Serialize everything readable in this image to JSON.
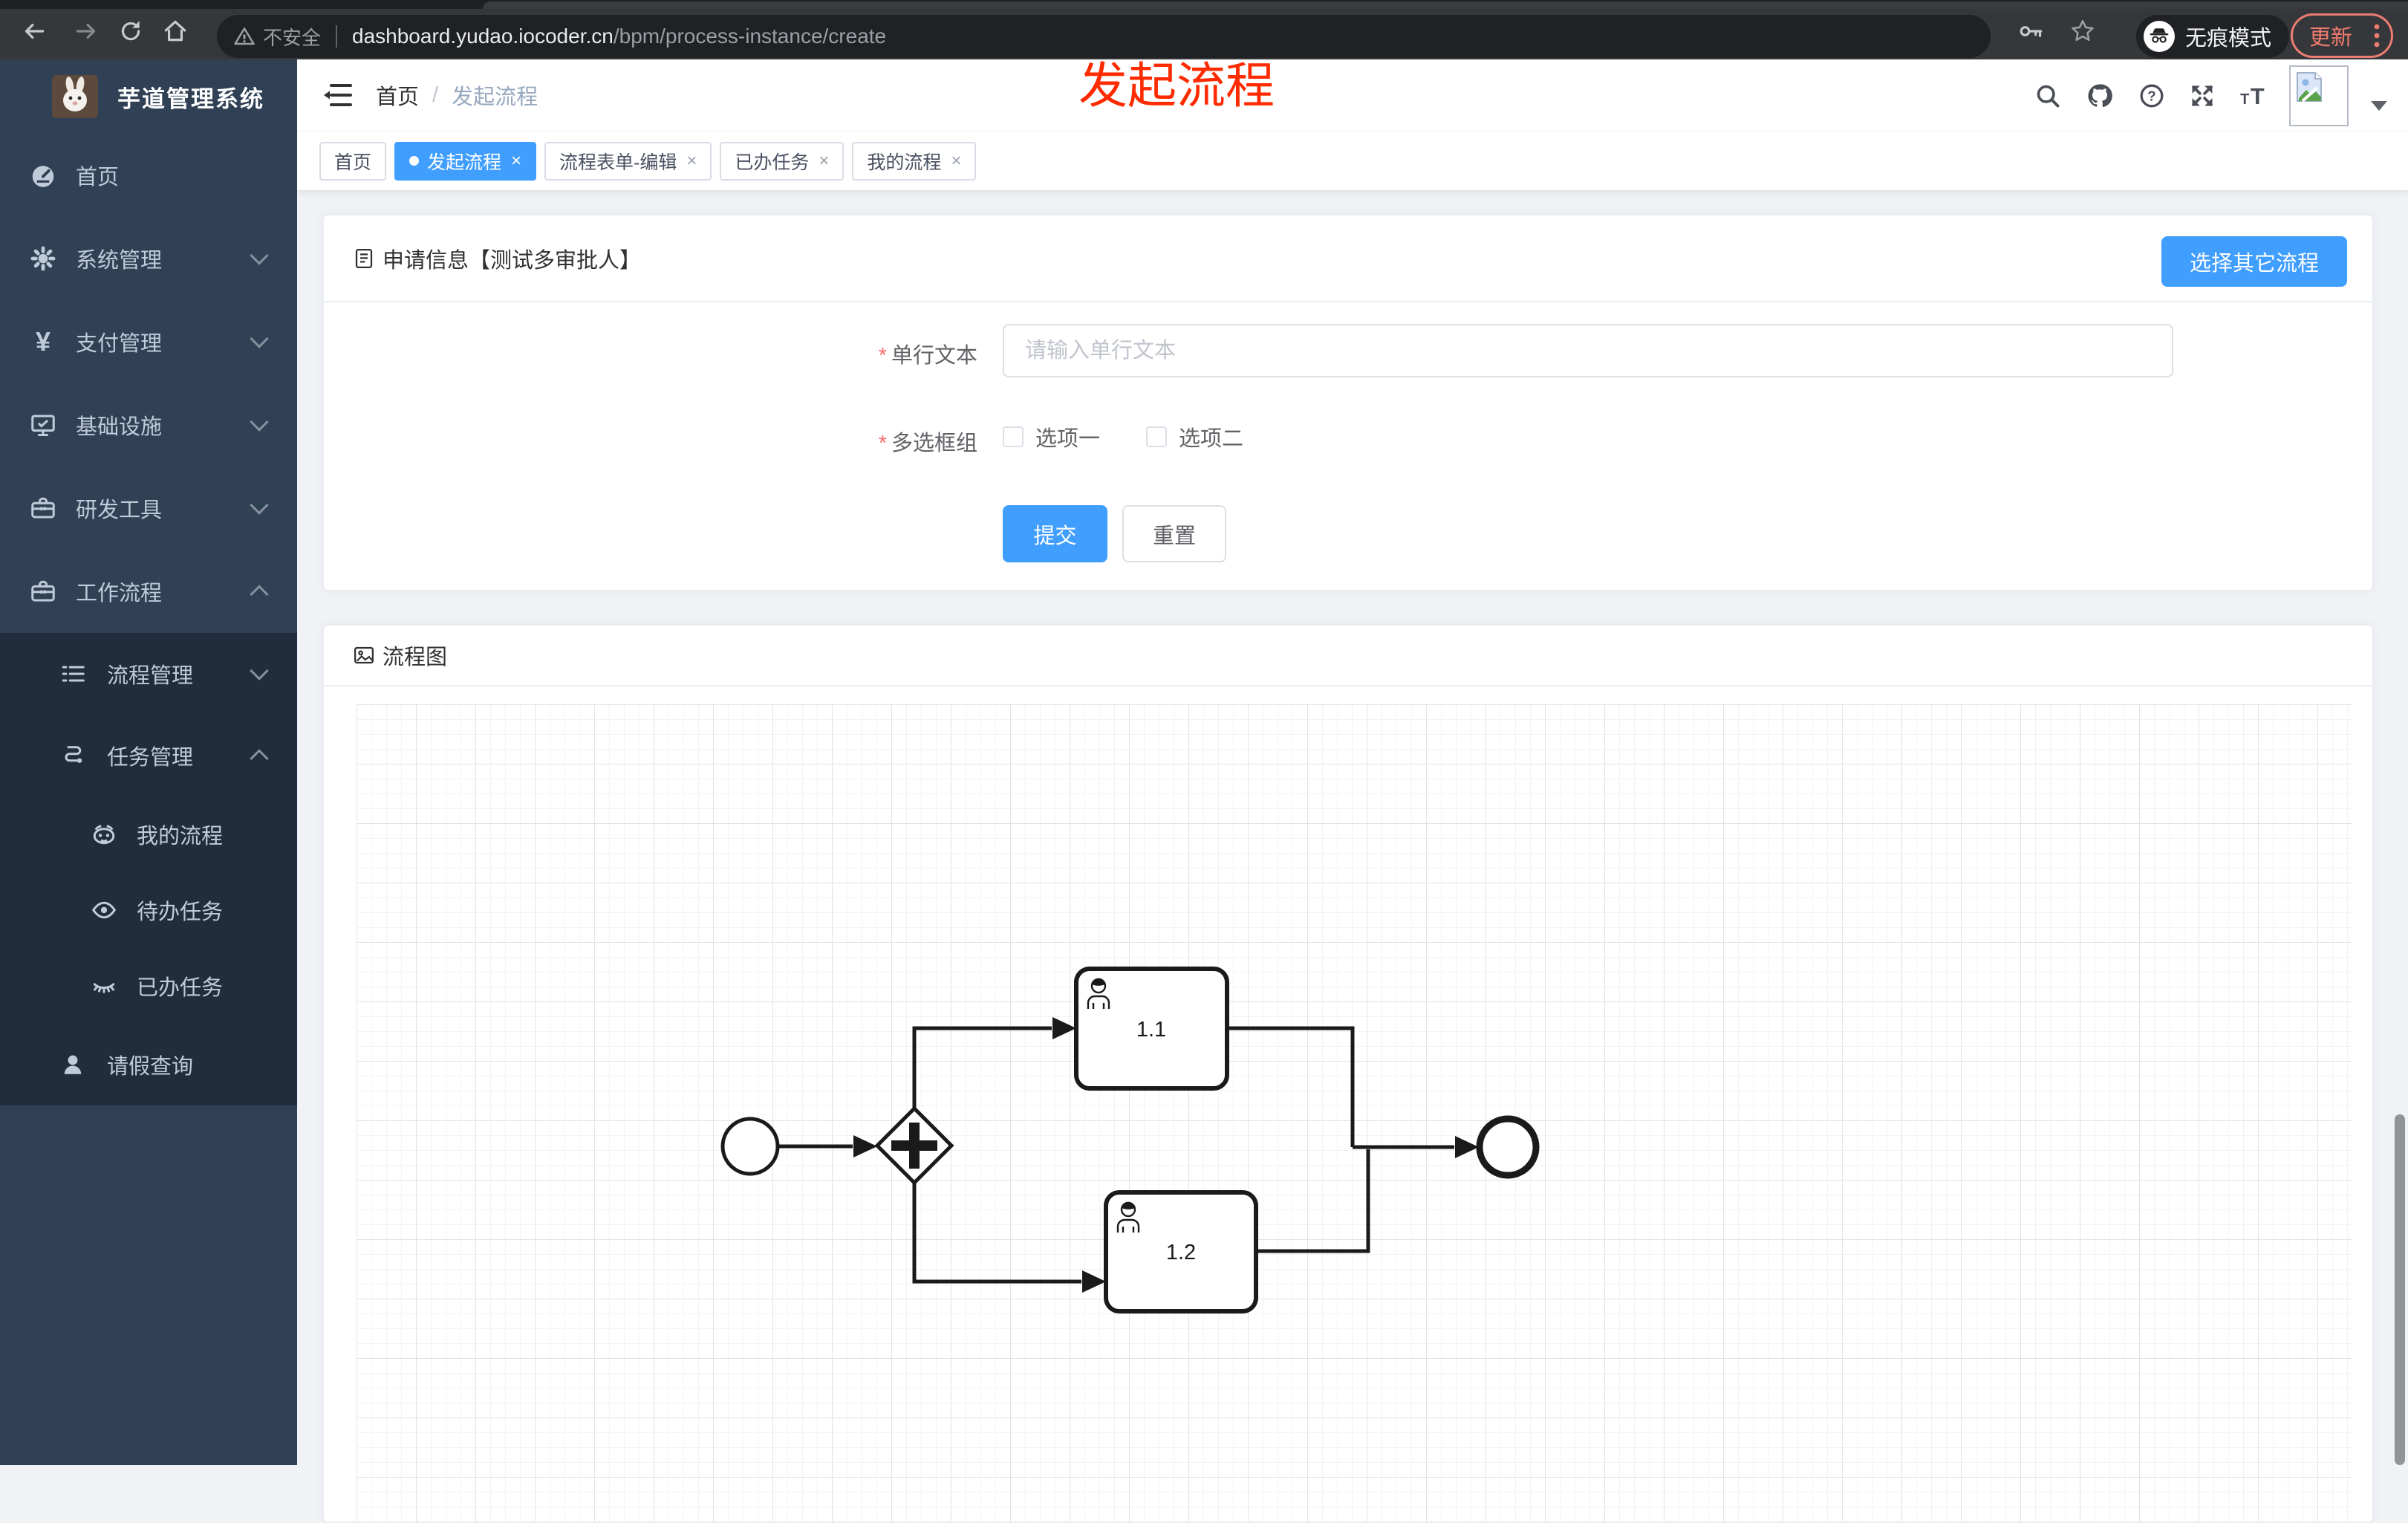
{
  "browser": {
    "security_label": "不安全",
    "url_host": "dashboard.yudao.iocoder.cn",
    "url_path": "/bpm/process-instance/create",
    "incognito_label": "无痕模式",
    "update_label": "更新"
  },
  "annotation": {
    "text": "发起流程",
    "color": "#ff2b00"
  },
  "sidebar": {
    "title": "芋道管理系统",
    "items": [
      {
        "label": "首页",
        "icon": "dashboard-icon",
        "level": 1
      },
      {
        "label": "系统管理",
        "icon": "gear-icon",
        "level": 1,
        "chevron": "down"
      },
      {
        "label": "支付管理",
        "icon": "yen-icon",
        "level": 1,
        "chevron": "down"
      },
      {
        "label": "基础设施",
        "icon": "monitor-icon",
        "level": 1,
        "chevron": "down"
      },
      {
        "label": "研发工具",
        "icon": "toolbox-icon",
        "level": 1,
        "chevron": "down"
      },
      {
        "label": "工作流程",
        "icon": "workflow-icon",
        "level": 1,
        "chevron": "up",
        "expanded": true
      },
      {
        "label": "流程管理",
        "icon": "process-list-icon",
        "level": 2,
        "chevron": "down"
      },
      {
        "label": "任务管理",
        "icon": "task-flow-icon",
        "level": 2,
        "chevron": "up",
        "expanded": true
      },
      {
        "label": "我的流程",
        "icon": "my-process-icon",
        "level": 3
      },
      {
        "label": "待办任务",
        "icon": "todo-eye-icon",
        "level": 3
      },
      {
        "label": "已办任务",
        "icon": "done-eye-icon",
        "level": 3
      },
      {
        "label": "请假查询",
        "icon": "person-icon",
        "level": 2
      }
    ]
  },
  "header": {
    "breadcrumb_home": "首页",
    "breadcrumb_sep": "/",
    "breadcrumb_current": "发起流程"
  },
  "tabs": [
    {
      "label": "首页",
      "active": false,
      "closable": false
    },
    {
      "label": "发起流程",
      "active": true,
      "closable": true
    },
    {
      "label": "流程表单-编辑",
      "active": false,
      "closable": true
    },
    {
      "label": "已办任务",
      "active": false,
      "closable": true
    },
    {
      "label": "我的流程",
      "active": false,
      "closable": true
    }
  ],
  "form_card": {
    "title": "申请信息【测试多审批人】",
    "select_other_label": "选择其它流程",
    "field_text": {
      "label": "单行文本",
      "required": true,
      "placeholder": "请输入单行文本",
      "value": ""
    },
    "field_checkbox": {
      "label": "多选框组",
      "required": true,
      "options": [
        {
          "label": "选项一",
          "checked": false
        },
        {
          "label": "选项二",
          "checked": false
        }
      ]
    },
    "submit_label": "提交",
    "reset_label": "重置"
  },
  "diagram_card": {
    "title": "流程图",
    "bpmn": {
      "nodes": [
        {
          "id": "start",
          "type": "startEvent"
        },
        {
          "id": "gateway",
          "type": "parallelGateway"
        },
        {
          "id": "task1",
          "type": "userTask",
          "label": "1.1"
        },
        {
          "id": "task2",
          "type": "userTask",
          "label": "1.2"
        },
        {
          "id": "end",
          "type": "endEvent"
        }
      ],
      "flows": [
        [
          "start",
          "gateway"
        ],
        [
          "gateway",
          "task1"
        ],
        [
          "gateway",
          "task2"
        ],
        [
          "task1",
          "end"
        ],
        [
          "task2",
          "end"
        ]
      ]
    }
  },
  "ui": {
    "required_mark": "*",
    "close_glyph": "×"
  },
  "colors": {
    "accent_blue": "#409eff",
    "sidebar_bg": "#304156",
    "submenu_bg": "#1f2d3d",
    "annotation_red": "#ff2b00",
    "update_salmon": "#f07b6f",
    "required_red": "#f56c6c"
  }
}
